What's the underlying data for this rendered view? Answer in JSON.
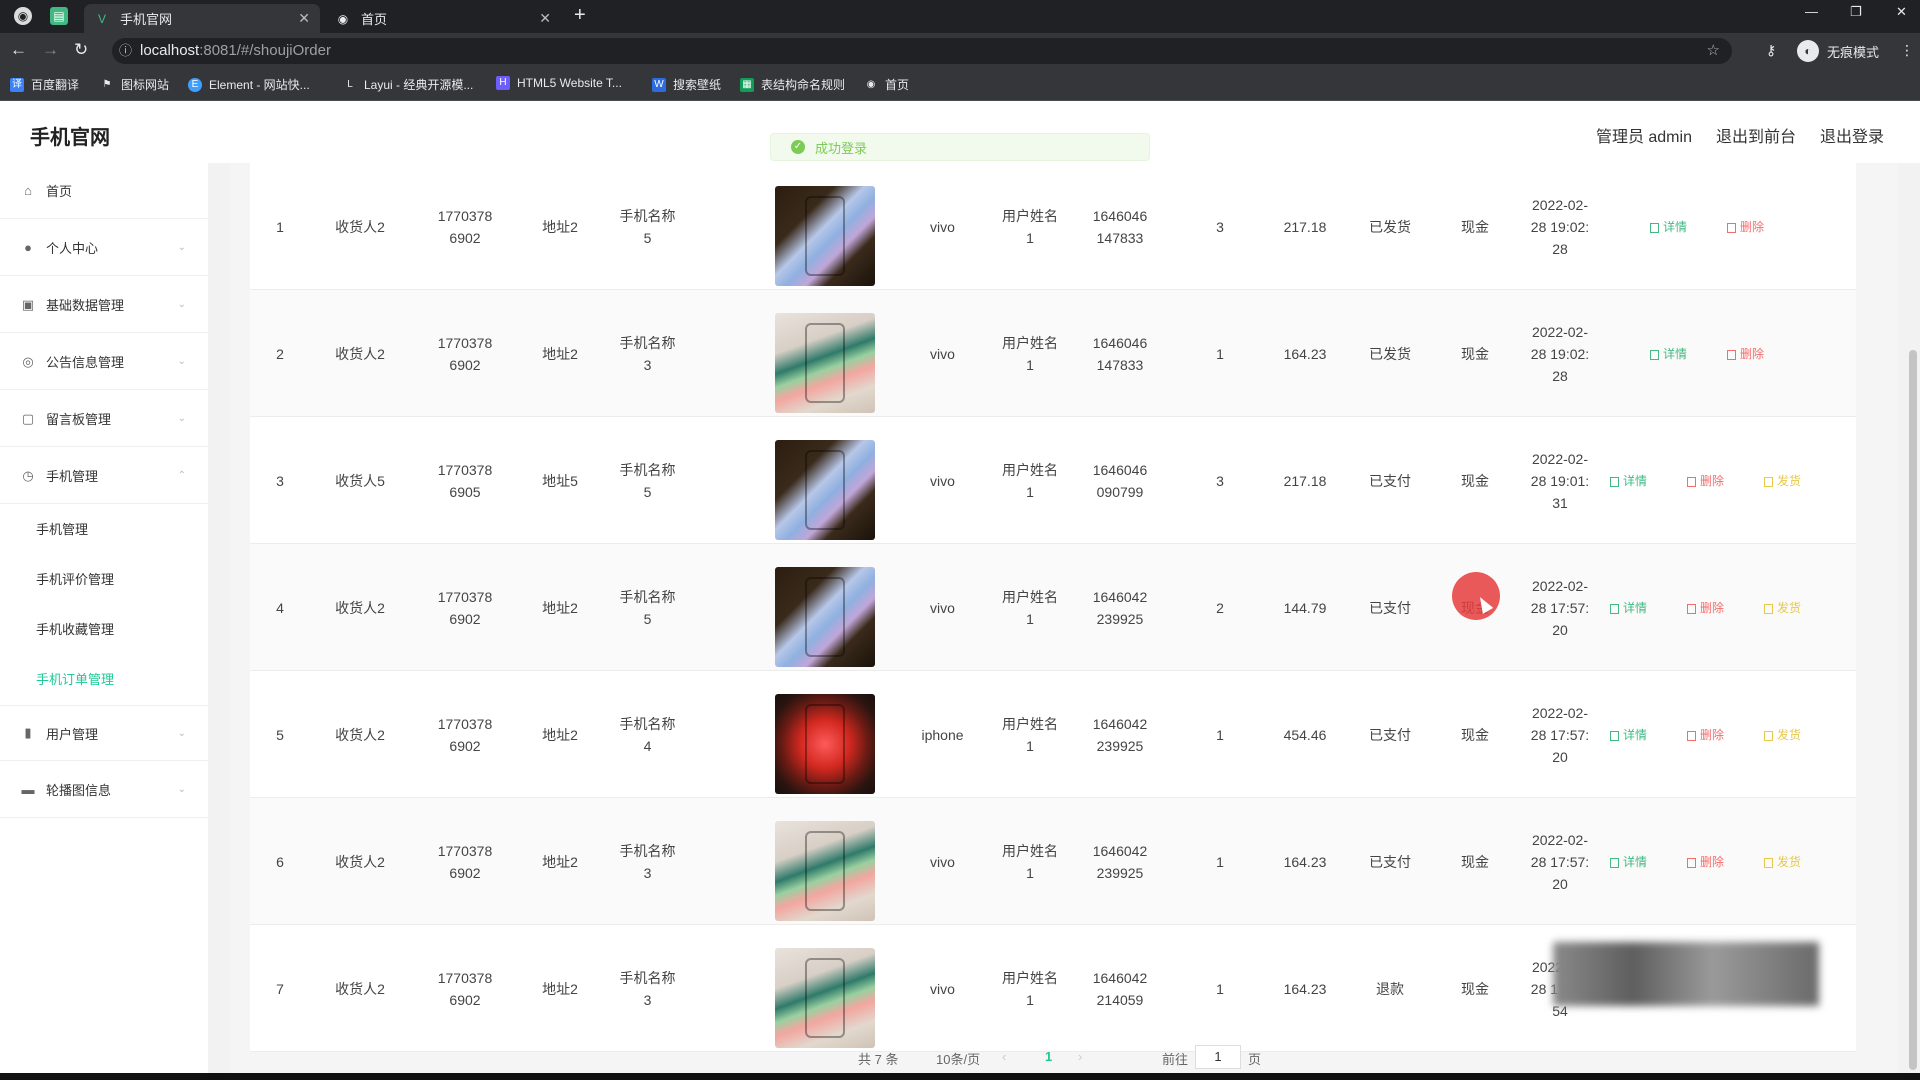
{
  "browser": {
    "tabs": [
      {
        "title": "手机官网",
        "active": true
      },
      {
        "title": "首页",
        "active": false
      }
    ],
    "url_host": "localhost",
    "url_rest": ":8081/#/shoujiOrder",
    "profile_label": "无痕模式",
    "bookmarks": [
      "百度翻译",
      "图标网站",
      "Element - 网站快...",
      "Layui - 经典开源模...",
      "HTML5 Website T...",
      "搜索壁纸",
      "表结构命名规则",
      "首页"
    ]
  },
  "app": {
    "title": "手机官网",
    "header_links": [
      "管理员 admin",
      "退出到前台",
      "退出登录"
    ],
    "toast": "成功登录"
  },
  "sidebar": {
    "items": [
      {
        "label": "首页",
        "icon": "home-icon",
        "has_arrow": false
      },
      {
        "label": "个人中心",
        "icon": "user-icon",
        "has_arrow": true
      },
      {
        "label": "基础数据管理",
        "icon": "database-icon",
        "has_arrow": true
      },
      {
        "label": "公告信息管理",
        "icon": "notice-icon",
        "has_arrow": true
      },
      {
        "label": "留言板管理",
        "icon": "message-icon",
        "has_arrow": true
      },
      {
        "label": "手机管理",
        "icon": "phone-icon",
        "has_arrow": true,
        "expanded": true
      }
    ],
    "sub_items": [
      {
        "label": "手机管理",
        "active": false
      },
      {
        "label": "手机评价管理",
        "active": false
      },
      {
        "label": "手机收藏管理",
        "active": false
      },
      {
        "label": "手机订单管理",
        "active": true
      }
    ],
    "bottom_items": [
      {
        "label": "用户管理",
        "icon": "chart-icon",
        "has_arrow": true
      },
      {
        "label": "轮播图信息",
        "icon": "image-icon",
        "has_arrow": true
      }
    ]
  },
  "table": {
    "rows": [
      {
        "index": "1",
        "receiver": "收货人2",
        "phone_a": "1770378",
        "phone_b": "6902",
        "address": "地址2",
        "product_a": "手机名称",
        "product_b": "5",
        "image": "ph-dark",
        "brand": "vivo",
        "user_a": "用户姓名",
        "user_b": "1",
        "order_a": "1646046",
        "order_b": "147833",
        "qty": "3",
        "price": "217.18",
        "status": "已发货",
        "payment": "现金",
        "time_a": "2022-02-",
        "time_b": "28 19:02:",
        "time_c": "28",
        "actions": [
          "详情",
          "删除"
        ]
      },
      {
        "index": "2",
        "receiver": "收货人2",
        "phone_a": "1770378",
        "phone_b": "6902",
        "address": "地址2",
        "product_a": "手机名称",
        "product_b": "3",
        "image": "ph-hand",
        "brand": "vivo",
        "user_a": "用户姓名",
        "user_b": "1",
        "order_a": "1646046",
        "order_b": "147833",
        "qty": "1",
        "price": "164.23",
        "status": "已发货",
        "payment": "现金",
        "time_a": "2022-02-",
        "time_b": "28 19:02:",
        "time_c": "28",
        "actions": [
          "详情",
          "删除"
        ]
      },
      {
        "index": "3",
        "receiver": "收货人5",
        "phone_a": "1770378",
        "phone_b": "6905",
        "address": "地址5",
        "product_a": "手机名称",
        "product_b": "5",
        "image": "ph-dark",
        "brand": "vivo",
        "user_a": "用户姓名",
        "user_b": "1",
        "order_a": "1646046",
        "order_b": "090799",
        "qty": "3",
        "price": "217.18",
        "status": "已支付",
        "payment": "现金",
        "time_a": "2022-02-",
        "time_b": "28 19:01:",
        "time_c": "31",
        "actions": [
          "详情",
          "删除",
          "发货"
        ]
      },
      {
        "index": "4",
        "receiver": "收货人2",
        "phone_a": "1770378",
        "phone_b": "6902",
        "address": "地址2",
        "product_a": "手机名称",
        "product_b": "5",
        "image": "ph-dark",
        "brand": "vivo",
        "user_a": "用户姓名",
        "user_b": "1",
        "order_a": "1646042",
        "order_b": "239925",
        "qty": "2",
        "price": "144.79",
        "status": "已支付",
        "payment": "现金",
        "time_a": "2022-02-",
        "time_b": "28 17:57:",
        "time_c": "20",
        "actions": [
          "详情",
          "删除",
          "发货"
        ]
      },
      {
        "index": "5",
        "receiver": "收货人2",
        "phone_a": "1770378",
        "phone_b": "6902",
        "address": "地址2",
        "product_a": "手机名称",
        "product_b": "4",
        "image": "ph-iphone",
        "brand": "iphone",
        "user_a": "用户姓名",
        "user_b": "1",
        "order_a": "1646042",
        "order_b": "239925",
        "qty": "1",
        "price": "454.46",
        "status": "已支付",
        "payment": "现金",
        "time_a": "2022-02-",
        "time_b": "28 17:57:",
        "time_c": "20",
        "actions": [
          "详情",
          "删除",
          "发货"
        ]
      },
      {
        "index": "6",
        "receiver": "收货人2",
        "phone_a": "1770378",
        "phone_b": "6902",
        "address": "地址2",
        "product_a": "手机名称",
        "product_b": "3",
        "image": "ph-hand",
        "brand": "vivo",
        "user_a": "用户姓名",
        "user_b": "1",
        "order_a": "1646042",
        "order_b": "239925",
        "qty": "1",
        "price": "164.23",
        "status": "已支付",
        "payment": "现金",
        "time_a": "2022-02-",
        "time_b": "28 17:57:",
        "time_c": "20",
        "actions": [
          "详情",
          "删除",
          "发货"
        ]
      },
      {
        "index": "7",
        "receiver": "收货人2",
        "phone_a": "1770378",
        "phone_b": "6902",
        "address": "地址2",
        "product_a": "手机名称",
        "product_b": "3",
        "image": "ph-hand",
        "brand": "vivo",
        "user_a": "用户姓名",
        "user_b": "1",
        "order_a": "1646042",
        "order_b": "214059",
        "qty": "1",
        "price": "164.23",
        "status": "退款",
        "payment": "现金",
        "time_a": "2022-02-",
        "time_b": "28 17:56:",
        "time_c": "54",
        "actions": []
      }
    ]
  },
  "pagination": {
    "total": "共 7 条",
    "page_size": "10条/页",
    "current": "1",
    "goto_label": "前往",
    "goto_value": "1",
    "page_suffix": "页"
  },
  "colors": {
    "accent": "#20c997",
    "detail": "#42b983",
    "delete": "#f56c6c",
    "pay": "#e6c84b"
  }
}
